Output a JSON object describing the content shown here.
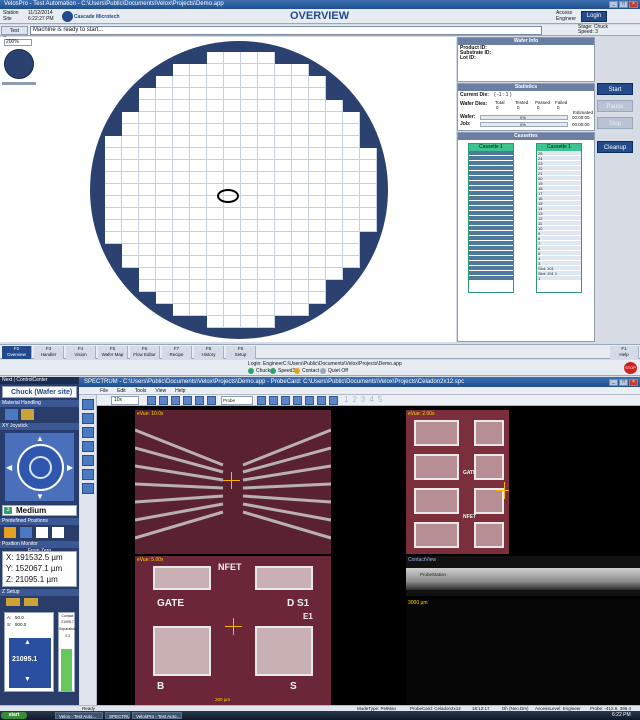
{
  "window": {
    "title": "VelosPro - Test Automation - C:\\Users\\Public\\Documents\\Velox\\Projects\\Demo.app",
    "min": "_",
    "max": "□",
    "close": "×"
  },
  "header": {
    "station_label": "Station",
    "station_value": "11/12/2014",
    "site_label": "Site",
    "site_value": "6:22:27 PM",
    "brand": "Cascade Microtech",
    "title": "OVERVIEW",
    "access_label": "Access",
    "access_value": "Engineer",
    "login": "Login",
    "stage_label": "Stage: Chuck",
    "speed_label": "Speed: 3"
  },
  "status": {
    "test_sequence": "Test Sequence",
    "message": "Machine is ready to start..."
  },
  "wafer": {
    "zoom": "200%"
  },
  "wafer_info": {
    "title": "Wafer Info",
    "product": "Product ID:",
    "substrate": "Substrate ID:",
    "lot": "Lot ID:"
  },
  "statistics": {
    "title": "Statistics",
    "current_die_label": "Current Die:",
    "current_die_value": "( -1 : 1 )",
    "wafer_dies_label": "Wafer Dies:",
    "total": "Total",
    "tested": "Tested",
    "passed": "Passed",
    "failed": "Failed",
    "total_v": "0",
    "tested_v": "0",
    "passed_v": "0",
    "failed_v": "0",
    "estimated": "Estimated",
    "wafer_label": "Wafer:",
    "wafer_pct": "0%",
    "wafer_time": "00:00:00",
    "wafer_progress": 0,
    "job_label": "Job:",
    "job_pct": "0%",
    "job_time": "00:00:00",
    "job_progress": 0
  },
  "cassettes": {
    "title": "Cassettes",
    "c1": "Cassette 1",
    "c2": "Cassette 1",
    "c2_labels": [
      "25",
      "24",
      "23",
      "22",
      "21",
      "20",
      "19",
      "18",
      "17",
      "16",
      "15",
      "14",
      "13",
      "12",
      "11",
      "10",
      "9",
      "8",
      "7",
      "6",
      "5",
      "4",
      "3",
      "Slot: 101",
      "Slot: 101 1",
      "1"
    ]
  },
  "buttons": {
    "start": "Start",
    "pause": "Pause",
    "stop": "Stop",
    "cleanup": "Cleanup"
  },
  "nav": [
    {
      "key": "F2",
      "label": "Overview"
    },
    {
      "key": "F3",
      "label": "Handler"
    },
    {
      "key": "F4",
      "label": "Vision"
    },
    {
      "key": "F5",
      "label": "Wafer Map"
    },
    {
      "key": "F6",
      "label": "Flow Editor"
    },
    {
      "key": "F7",
      "label": "Recipe"
    },
    {
      "key": "F8",
      "label": "History"
    },
    {
      "key": "F9",
      "label": "Setup"
    }
  ],
  "help": {
    "key": "F1",
    "label": "Help"
  },
  "login_info": {
    "text": "Login: Engineer",
    "path": "C:\\Users\\Public\\Documents\\Velox\\Projects\\Demo.app",
    "chuck": "Chuck",
    "speed": "Speed3",
    "contact": "Contact",
    "quiet": "Quiet Off",
    "stop": "STOP"
  },
  "velox": {
    "title": "SPECTRUM - C:\\Users\\Public\\Documents\\Velox\\Projects\\Demo.app - ProbeCard: C:\\Users\\Public\\Documents\\Velox\\Projects\\Celadon2x12.spc",
    "menu": [
      "File",
      "Edit",
      "Tools",
      "View",
      "Help"
    ],
    "zoom": "10x",
    "profile": "Probe Position",
    "numbers": [
      "1",
      "2",
      "3",
      "4",
      "5"
    ]
  },
  "left_panel": {
    "station": "Next  |  ControlCenter",
    "chuck": "Chuck (Wafer site)",
    "material": "Material Handling",
    "joystick": "XY Joystick",
    "speed_num": "3",
    "speed": "Medium",
    "predefined": "Predefined Positions",
    "monitor": "Position Monitor",
    "from_zero": "From Zero",
    "x": "X:  191532.5 µm",
    "y": "Y:  152067.1 µm",
    "z": "Z:  21095.1 µm",
    "zsetup": "Z Setup",
    "contact_label": "Contact",
    "contact_val": "21095.7",
    "sep_label": "Separation",
    "sep_val": "0.3",
    "a_label": "A:",
    "a_val": "50.0",
    "s_label": "S:",
    "s_val": "500.0",
    "z_big": "21095.1"
  },
  "views": {
    "v1": "eVue: 10.0x",
    "v2": "eVue: 2.00x",
    "v3": "eVue: 5.00x",
    "v4": "ContactView",
    "v4b": "ProbeStation",
    "v5": "3000 µm",
    "scale1": "200 µm",
    "pads": {
      "gate": "GATE",
      "nfet": "NFET",
      "ds": "D S1",
      "e1": "E1",
      "b": "B",
      "s": "S"
    }
  },
  "statusbar": {
    "ready": "Ready",
    "mode": "ModeType: PetMan",
    "probecard": "ProbeCard: Celadon2x12",
    "time": "18:13:17",
    "user": "Dh (Neo.Dm)",
    "access": "AccessLevel: Engineer",
    "probe": "Probe: -412.6, 396.4"
  },
  "taskbar": {
    "start": "start",
    "tasks": [
      "Velox - Test Auto...",
      "SPECTRUM",
      "VelosPro - Test Auto..."
    ],
    "clock": "6:22 PM"
  }
}
